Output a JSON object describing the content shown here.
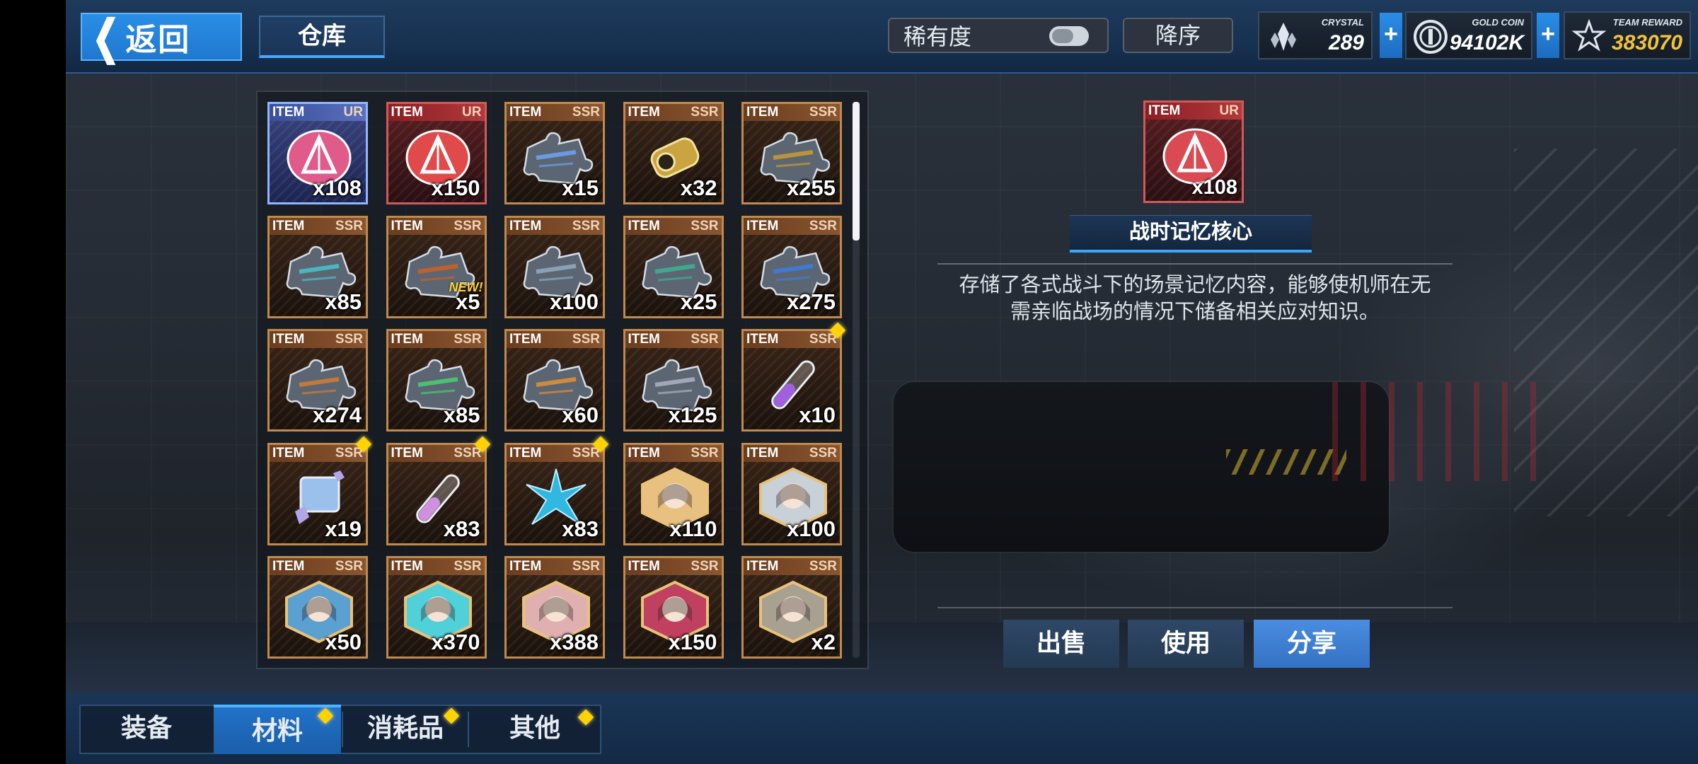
{
  "topbar": {
    "back_label": "返回",
    "tab_label": "仓库",
    "sort_label": "稀有度",
    "order_label": "降序",
    "currencies": [
      {
        "caption": "CRYSTAL",
        "value": "289",
        "icon": "crystal-icon"
      },
      {
        "caption": "GOLD COIN",
        "value": "94102K",
        "icon": "gold-coin-icon"
      },
      {
        "caption": "TEAM REWARD",
        "value": "383070",
        "icon": "team-reward-icon"
      }
    ],
    "plus_label": "+"
  },
  "items": [
    {
      "type": "ITEM",
      "rarity": "UR",
      "qty": "x108",
      "art": "memory-core",
      "color": "#e05a8a"
    },
    {
      "type": "ITEM",
      "rarity": "UR",
      "qty": "x150",
      "art": "red-chip",
      "color": "#e04a4a"
    },
    {
      "type": "ITEM",
      "rarity": "SSR",
      "qty": "x15",
      "art": "puzzle",
      "color": "#6a9adf"
    },
    {
      "type": "ITEM",
      "rarity": "SSR",
      "qty": "x32",
      "art": "gold-capsule",
      "color": "#c9a440"
    },
    {
      "type": "ITEM",
      "rarity": "SSR",
      "qty": "x255",
      "art": "puzzle",
      "color": "#b8953a"
    },
    {
      "type": "ITEM",
      "rarity": "SSR",
      "qty": "x85",
      "art": "puzzle",
      "color": "#4ab6c0"
    },
    {
      "type": "ITEM",
      "rarity": "SSR",
      "qty": "x5",
      "art": "puzzle",
      "color": "#c0602a",
      "new": "NEW!"
    },
    {
      "type": "ITEM",
      "rarity": "SSR",
      "qty": "x100",
      "art": "puzzle",
      "color": "#8aa0b8"
    },
    {
      "type": "ITEM",
      "rarity": "SSR",
      "qty": "x25",
      "art": "puzzle",
      "color": "#3fa890"
    },
    {
      "type": "ITEM",
      "rarity": "SSR",
      "qty": "x275",
      "art": "puzzle",
      "color": "#3f7ad0"
    },
    {
      "type": "ITEM",
      "rarity": "SSR",
      "qty": "x274",
      "art": "puzzle",
      "color": "#c07a3a"
    },
    {
      "type": "ITEM",
      "rarity": "SSR",
      "qty": "x85",
      "art": "puzzle",
      "color": "#4ac070"
    },
    {
      "type": "ITEM",
      "rarity": "SSR",
      "qty": "x60",
      "art": "puzzle",
      "color": "#d08a3a"
    },
    {
      "type": "ITEM",
      "rarity": "SSR",
      "qty": "x125",
      "art": "puzzle",
      "color": "#a0a8b8"
    },
    {
      "type": "ITEM",
      "rarity": "SSR",
      "qty": "x10",
      "art": "test-tube",
      "color": "#a060e0",
      "dot": true
    },
    {
      "type": "ITEM",
      "rarity": "SSR",
      "qty": "x19",
      "art": "ticket",
      "color": "#7a9ad8",
      "dot": true
    },
    {
      "type": "ITEM",
      "rarity": "SSR",
      "qty": "x83",
      "art": "test-tube",
      "color": "#d090e0",
      "dot": true
    },
    {
      "type": "ITEM",
      "rarity": "SSR",
      "qty": "x83",
      "art": "crystal",
      "color": "#30b8e0",
      "dot": true
    },
    {
      "type": "ITEM",
      "rarity": "SSR",
      "qty": "x110",
      "art": "portrait",
      "color": "#e8c080"
    },
    {
      "type": "ITEM",
      "rarity": "SSR",
      "qty": "x100",
      "art": "portrait",
      "color": "#c8d0d8"
    },
    {
      "type": "ITEM",
      "rarity": "SSR",
      "qty": "x50",
      "art": "portrait",
      "color": "#5aa0d0"
    },
    {
      "type": "ITEM",
      "rarity": "SSR",
      "qty": "x370",
      "art": "portrait",
      "color": "#50d0d8"
    },
    {
      "type": "ITEM",
      "rarity": "SSR",
      "qty": "x388",
      "art": "portrait",
      "color": "#e0b0b0"
    },
    {
      "type": "ITEM",
      "rarity": "SSR",
      "qty": "x150",
      "art": "portrait",
      "color": "#c04060"
    },
    {
      "type": "ITEM",
      "rarity": "SSR",
      "qty": "x2",
      "art": "portrait",
      "color": "#a8a090"
    }
  ],
  "detail": {
    "type": "ITEM",
    "rarity": "UR",
    "qty": "x108",
    "name": "战时记忆核心",
    "desc_line1": "存储了各式战斗下的场景记忆内容，能够使机师在无",
    "desc_line2": "需亲临战场的情况下储备相关应对知识。"
  },
  "actions": {
    "sell": "出售",
    "use": "使用",
    "share": "分享"
  },
  "bottom_tabs": [
    {
      "label": "装备",
      "active": false,
      "dot": false
    },
    {
      "label": "材料",
      "active": true,
      "dot": true
    },
    {
      "label": "消耗品",
      "active": false,
      "dot": true
    },
    {
      "label": "其他",
      "active": false,
      "dot": true
    }
  ]
}
